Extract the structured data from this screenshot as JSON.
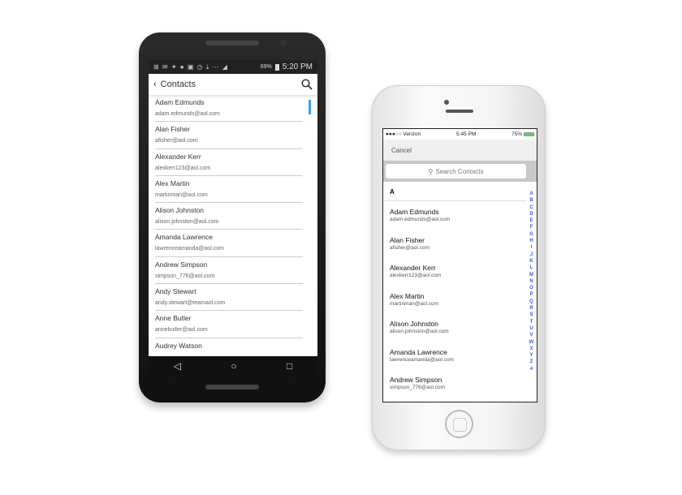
{
  "android": {
    "status": {
      "battery": "69%",
      "time": "5:20 PM"
    },
    "header": {
      "title": "Contacts"
    },
    "contacts": [
      {
        "name": "Adam Edmunds",
        "email": "adam.edmunds@aol.com"
      },
      {
        "name": "Alan Fisher",
        "email": "afisher@aol.com"
      },
      {
        "name": "Alexander Kerr",
        "email": "alexkerr123@aol.com"
      },
      {
        "name": "Alex Martin",
        "email": "martinman@aol.com"
      },
      {
        "name": "Alison Johnston",
        "email": "alison.johnston@aol.com"
      },
      {
        "name": "Amanda Lawrence",
        "email": "lawrenceamanda@aol.com"
      },
      {
        "name": "Andrew Simpson",
        "email": "simpson_776@aol.com"
      },
      {
        "name": "Andy Stewart",
        "email": "andy.stewart@teamaol.com"
      },
      {
        "name": "Anne Butler",
        "email": "annebutler@aol.com"
      },
      {
        "name": "Audrey Watson",
        "email": ""
      }
    ],
    "accent": "#3aa0f0"
  },
  "iphone": {
    "status": {
      "carrier": "●●●○○ Verizon",
      "time": "5:45 PM",
      "battery": "75%"
    },
    "cancel": "Cancel",
    "search_placeholder": "Search Contacts",
    "section": "A",
    "contacts": [
      {
        "name": "Adam Edmunds",
        "email": "adam.edmunds@aol.com"
      },
      {
        "name": "Alan Fisher",
        "email": "afisher@aol.com"
      },
      {
        "name": "Alexander Kerr",
        "email": "alexkerr123@aol.com"
      },
      {
        "name": "Alex Martin",
        "email": "martinman@aol.com"
      },
      {
        "name": "Alison Johnston",
        "email": "alison.johnston@aol.com"
      },
      {
        "name": "Amanda Lawrence",
        "email": "lawrenceamanda@aol.com"
      },
      {
        "name": "Andrew Simpson",
        "email": "simpson_776@aol.com"
      }
    ],
    "index": [
      "A",
      "B",
      "C",
      "D",
      "E",
      "F",
      "G",
      "H",
      "I",
      "J",
      "K",
      "L",
      "M",
      "N",
      "O",
      "P",
      "Q",
      "R",
      "S",
      "T",
      "U",
      "V",
      "W",
      "X",
      "Y",
      "Z",
      "#"
    ],
    "index_color": "#2c5cf0"
  }
}
